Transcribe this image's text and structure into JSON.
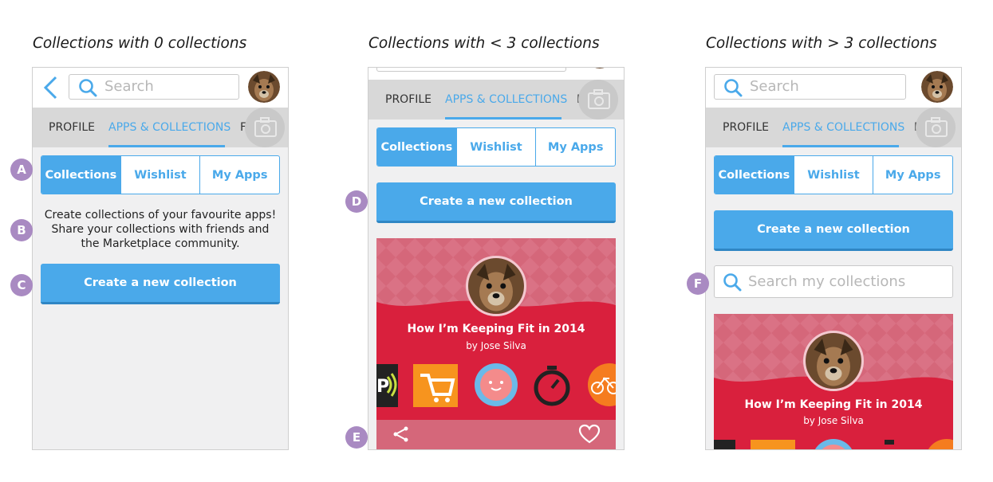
{
  "captions": {
    "first": "Collections with 0 collections",
    "second": "Collections with < 3 collections",
    "third": "Collections with > 3 collections"
  },
  "search": {
    "placeholder": "Search"
  },
  "tabs": {
    "profile": "PROFILE",
    "apps": "APPS & COLLECTIONS",
    "cut": "F"
  },
  "segments": {
    "collections": "Collections",
    "wishlist": "Wishlist",
    "myapps": "My Apps"
  },
  "empty_state": {
    "line1": "Create collections of your favourite apps!",
    "line2": "Share your collections with friends and",
    "line3": "the Marketplace community."
  },
  "create_button": "Create a new collection",
  "card": {
    "title": "How I’m Keeping Fit in 2014",
    "author": "by Jose Silva"
  },
  "search_collections": {
    "placeholder": "Search my collections"
  },
  "markers": {
    "a": "A",
    "b": "B",
    "c": "C",
    "d": "D",
    "e": "E",
    "f": "F"
  },
  "icons": [
    "back-chevron-icon",
    "search-icon",
    "camera-icon",
    "share-icon",
    "heart-icon",
    "app-icon-stopwatch",
    "app-icon-shopping-cart",
    "app-icon-face",
    "app-icon-bike",
    "app-icon-nfc"
  ],
  "colors": {
    "accent": "#4aa9ea",
    "card": "#d9203d",
    "card_pattern": "#d5677a",
    "marker": "#a98ac2",
    "tab_bar": "#d8d8d8",
    "screen_bg": "#f0f0f1"
  }
}
